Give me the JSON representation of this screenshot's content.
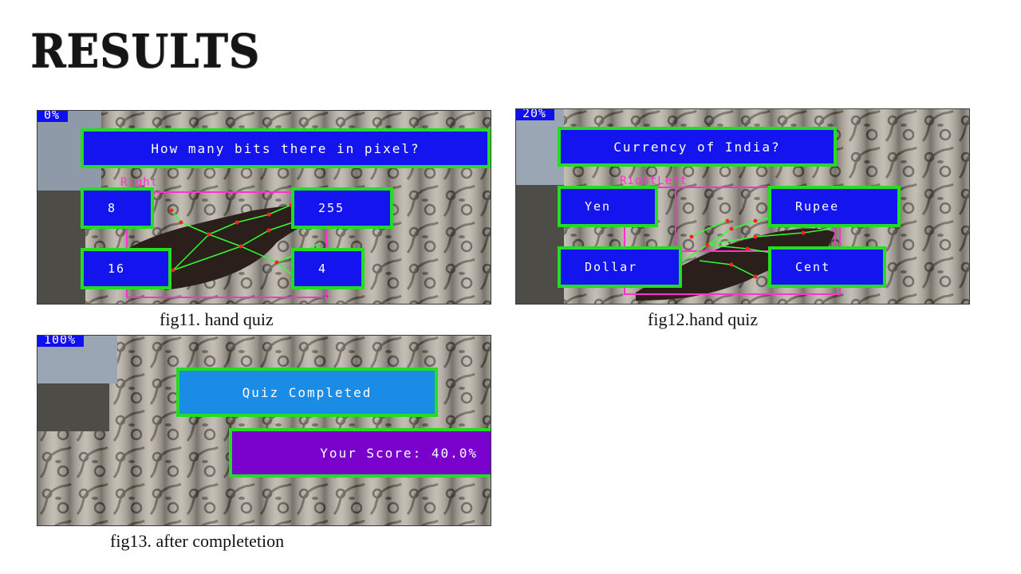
{
  "slide": {
    "title": "RESULTS"
  },
  "fig11": {
    "progress": "0%",
    "question": "How many bits there in pixel?",
    "hand_label": "Right",
    "answers": [
      "8",
      "255",
      "16",
      "4"
    ],
    "caption": "fig11.  hand quiz"
  },
  "fig12": {
    "progress": "20%",
    "question": "Currency of India?",
    "hand_label": "RightLeft",
    "answers": [
      "Yen",
      "Rupee",
      "Dollar",
      "Cent"
    ],
    "caption": "fig12.hand quiz"
  },
  "fig13": {
    "progress": "100%",
    "completed_label": "Quiz Completed",
    "score_label": "Your Score: 40.0%",
    "caption": "fig13.  after completetion"
  },
  "colors": {
    "box_fill": "#1414ee",
    "box_border": "#22dd22",
    "completed_fill": "#1a8ce6",
    "score_fill": "#7a00cc",
    "hand_box": "#ff33cc",
    "landmark": "#ff2222",
    "bone": "#33ff33"
  }
}
